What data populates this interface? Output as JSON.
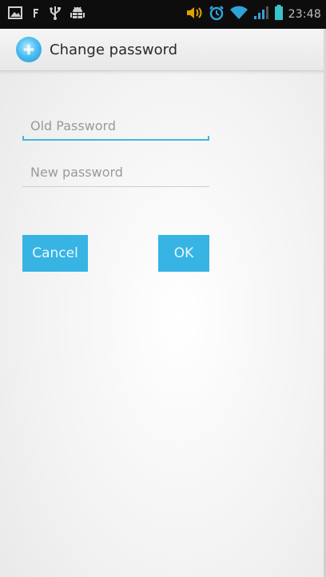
{
  "status_bar": {
    "time": "23:48",
    "left_icons": [
      "gallery-icon",
      "signal-f-icon",
      "usb-icon",
      "android-debug-icon"
    ],
    "right_icons": [
      "volume-icon",
      "alarm-icon",
      "wifi-icon",
      "cell-signal-icon",
      "battery-icon"
    ]
  },
  "action_bar": {
    "title": "Change password",
    "icon": "app-icon"
  },
  "form": {
    "old_password": {
      "placeholder": "Old Password",
      "value": ""
    },
    "new_password": {
      "placeholder": "New password",
      "value": ""
    }
  },
  "buttons": {
    "cancel_label": "Cancel",
    "ok_label": "OK"
  },
  "colors": {
    "accent": "#37b4e4",
    "status_bar_bg": "#0d0d0d",
    "battery": "#38c4c8"
  }
}
